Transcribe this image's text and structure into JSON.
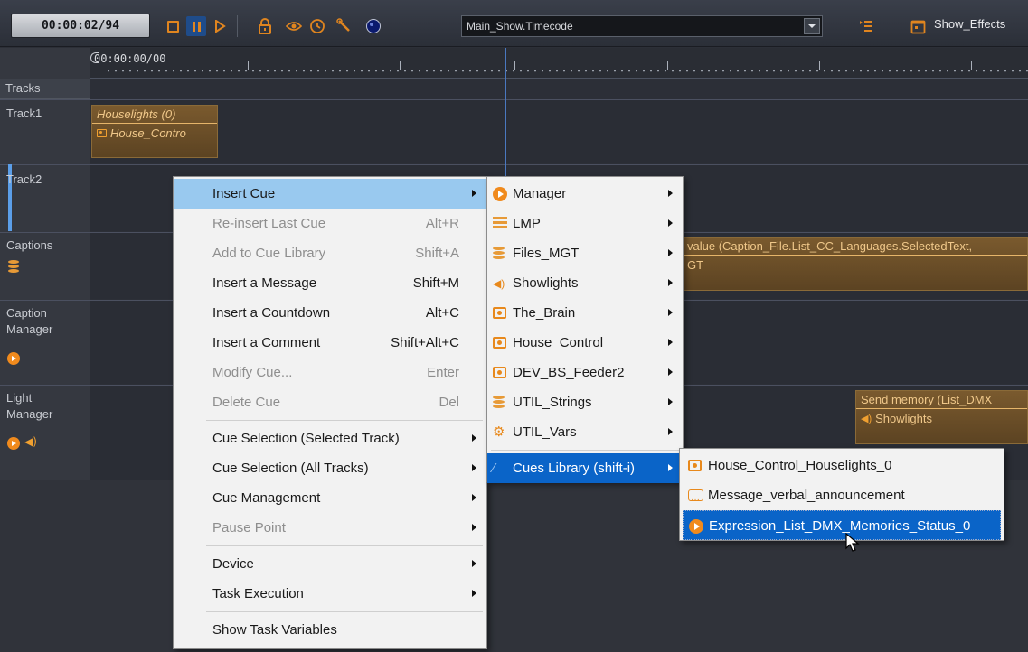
{
  "toolbar": {
    "timecode": "00:00:02/94",
    "timecode_source": "Main_Show.Timecode",
    "effects_label": "Show_Effects"
  },
  "ruler": {
    "start_label": "00:00:00/00"
  },
  "tracks": {
    "header": "Tracks",
    "rows": [
      {
        "name": "Track1"
      },
      {
        "name": "Track2"
      },
      {
        "name": "Captions"
      },
      {
        "name": "Caption Manager"
      },
      {
        "name": "Light Manager"
      }
    ]
  },
  "cues": {
    "houselights": {
      "title": "Houselights (0)",
      "sub": "House_Contro"
    },
    "caption": {
      "title": "value (Caption_File.List_CC_Languages.SelectedText,",
      "sub": "GT"
    },
    "send_memory": {
      "title": "Send memory (List_DMX",
      "sub": "Showlights"
    }
  },
  "context_menu": {
    "items": [
      {
        "label": "Insert Cue",
        "shortcut": "",
        "submenu": true,
        "disabled": false,
        "highlight": true
      },
      {
        "label": "Re-insert Last Cue",
        "shortcut": "Alt+R",
        "submenu": false,
        "disabled": true
      },
      {
        "label": "Add to Cue Library",
        "shortcut": "Shift+A",
        "submenu": false,
        "disabled": true
      },
      {
        "label": "Insert a Message",
        "shortcut": "Shift+M",
        "submenu": false,
        "disabled": false
      },
      {
        "label": "Insert a Countdown",
        "shortcut": "Alt+C",
        "submenu": false,
        "disabled": false
      },
      {
        "label": "Insert a Comment",
        "shortcut": "Shift+Alt+C",
        "submenu": false,
        "disabled": false
      },
      {
        "label": "Modify Cue...",
        "shortcut": "Enter",
        "submenu": false,
        "disabled": true
      },
      {
        "label": "Delete Cue",
        "shortcut": "Del",
        "submenu": false,
        "disabled": true
      },
      {
        "label": "Cue Selection (Selected Track)",
        "shortcut": "",
        "submenu": true,
        "disabled": false
      },
      {
        "label": "Cue Selection (All Tracks)",
        "shortcut": "",
        "submenu": true,
        "disabled": false
      },
      {
        "label": "Cue Management",
        "shortcut": "",
        "submenu": true,
        "disabled": false
      },
      {
        "label": "Pause Point",
        "shortcut": "",
        "submenu": true,
        "disabled": true
      },
      {
        "label": "Device",
        "shortcut": "",
        "submenu": true,
        "disabled": false
      },
      {
        "label": "Task Execution",
        "shortcut": "",
        "submenu": true,
        "disabled": false
      },
      {
        "label": "Show Task Variables",
        "shortcut": "",
        "submenu": false,
        "disabled": false
      }
    ]
  },
  "insert_cue_menu": {
    "items": [
      {
        "label": "Manager",
        "icon": "play-circle-icon"
      },
      {
        "label": "LMP",
        "icon": "lmp-icon"
      },
      {
        "label": "Files_MGT",
        "icon": "database-icon"
      },
      {
        "label": "Showlights",
        "icon": "speaker-icon"
      },
      {
        "label": "The_Brain",
        "icon": "device-box-icon"
      },
      {
        "label": "House_Control",
        "icon": "device-box-icon"
      },
      {
        "label": "DEV_BS_Feeder2",
        "icon": "device-box-icon"
      },
      {
        "label": "UTIL_Strings",
        "icon": "database-icon"
      },
      {
        "label": "UTIL_Vars",
        "icon": "gear-icon"
      },
      {
        "label": "Cues Library (shift-i)",
        "icon": "library-icon"
      }
    ]
  },
  "cues_library_menu": {
    "items": [
      {
        "label": "House_Control_Houselights_0",
        "icon": "device-box-icon"
      },
      {
        "label": "Message_verbal_announcement",
        "icon": "message-icon"
      },
      {
        "label": "Expression_List_DMX_Memories_Status_0",
        "icon": "play-circle-icon"
      }
    ]
  },
  "colors": {
    "accent_orange": "#f08a1d",
    "menu_highlight": "#99c9ef",
    "menu_selected": "#0a64c8"
  }
}
